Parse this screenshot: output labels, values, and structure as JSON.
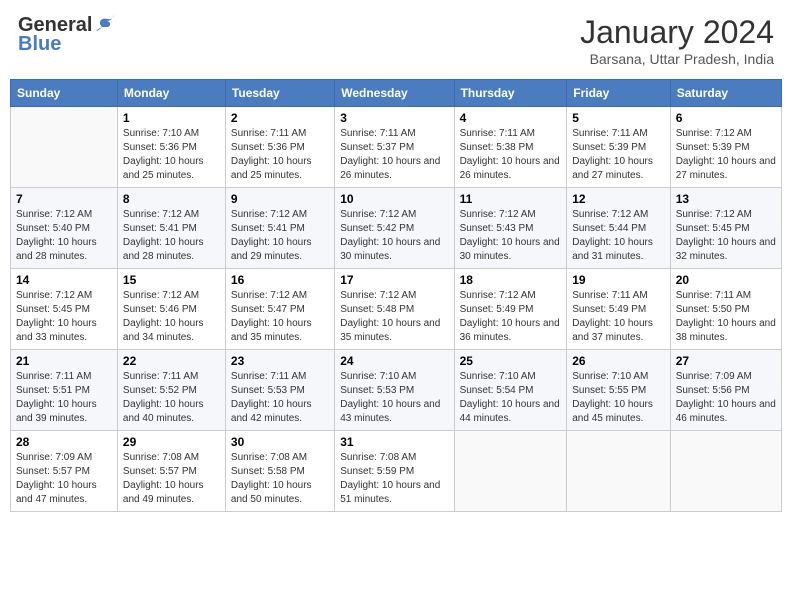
{
  "logo": {
    "general": "General",
    "blue": "Blue"
  },
  "title": "January 2024",
  "location": "Barsana, Uttar Pradesh, India",
  "headers": [
    "Sunday",
    "Monday",
    "Tuesday",
    "Wednesday",
    "Thursday",
    "Friday",
    "Saturday"
  ],
  "weeks": [
    [
      {
        "day": "",
        "sunrise": "",
        "sunset": "",
        "daylight": ""
      },
      {
        "day": "1",
        "sunrise": "Sunrise: 7:10 AM",
        "sunset": "Sunset: 5:36 PM",
        "daylight": "Daylight: 10 hours and 25 minutes."
      },
      {
        "day": "2",
        "sunrise": "Sunrise: 7:11 AM",
        "sunset": "Sunset: 5:36 PM",
        "daylight": "Daylight: 10 hours and 25 minutes."
      },
      {
        "day": "3",
        "sunrise": "Sunrise: 7:11 AM",
        "sunset": "Sunset: 5:37 PM",
        "daylight": "Daylight: 10 hours and 26 minutes."
      },
      {
        "day": "4",
        "sunrise": "Sunrise: 7:11 AM",
        "sunset": "Sunset: 5:38 PM",
        "daylight": "Daylight: 10 hours and 26 minutes."
      },
      {
        "day": "5",
        "sunrise": "Sunrise: 7:11 AM",
        "sunset": "Sunset: 5:39 PM",
        "daylight": "Daylight: 10 hours and 27 minutes."
      },
      {
        "day": "6",
        "sunrise": "Sunrise: 7:12 AM",
        "sunset": "Sunset: 5:39 PM",
        "daylight": "Daylight: 10 hours and 27 minutes."
      }
    ],
    [
      {
        "day": "7",
        "sunrise": "Sunrise: 7:12 AM",
        "sunset": "Sunset: 5:40 PM",
        "daylight": "Daylight: 10 hours and 28 minutes."
      },
      {
        "day": "8",
        "sunrise": "Sunrise: 7:12 AM",
        "sunset": "Sunset: 5:41 PM",
        "daylight": "Daylight: 10 hours and 28 minutes."
      },
      {
        "day": "9",
        "sunrise": "Sunrise: 7:12 AM",
        "sunset": "Sunset: 5:41 PM",
        "daylight": "Daylight: 10 hours and 29 minutes."
      },
      {
        "day": "10",
        "sunrise": "Sunrise: 7:12 AM",
        "sunset": "Sunset: 5:42 PM",
        "daylight": "Daylight: 10 hours and 30 minutes."
      },
      {
        "day": "11",
        "sunrise": "Sunrise: 7:12 AM",
        "sunset": "Sunset: 5:43 PM",
        "daylight": "Daylight: 10 hours and 30 minutes."
      },
      {
        "day": "12",
        "sunrise": "Sunrise: 7:12 AM",
        "sunset": "Sunset: 5:44 PM",
        "daylight": "Daylight: 10 hours and 31 minutes."
      },
      {
        "day": "13",
        "sunrise": "Sunrise: 7:12 AM",
        "sunset": "Sunset: 5:45 PM",
        "daylight": "Daylight: 10 hours and 32 minutes."
      }
    ],
    [
      {
        "day": "14",
        "sunrise": "Sunrise: 7:12 AM",
        "sunset": "Sunset: 5:45 PM",
        "daylight": "Daylight: 10 hours and 33 minutes."
      },
      {
        "day": "15",
        "sunrise": "Sunrise: 7:12 AM",
        "sunset": "Sunset: 5:46 PM",
        "daylight": "Daylight: 10 hours and 34 minutes."
      },
      {
        "day": "16",
        "sunrise": "Sunrise: 7:12 AM",
        "sunset": "Sunset: 5:47 PM",
        "daylight": "Daylight: 10 hours and 35 minutes."
      },
      {
        "day": "17",
        "sunrise": "Sunrise: 7:12 AM",
        "sunset": "Sunset: 5:48 PM",
        "daylight": "Daylight: 10 hours and 35 minutes."
      },
      {
        "day": "18",
        "sunrise": "Sunrise: 7:12 AM",
        "sunset": "Sunset: 5:49 PM",
        "daylight": "Daylight: 10 hours and 36 minutes."
      },
      {
        "day": "19",
        "sunrise": "Sunrise: 7:11 AM",
        "sunset": "Sunset: 5:49 PM",
        "daylight": "Daylight: 10 hours and 37 minutes."
      },
      {
        "day": "20",
        "sunrise": "Sunrise: 7:11 AM",
        "sunset": "Sunset: 5:50 PM",
        "daylight": "Daylight: 10 hours and 38 minutes."
      }
    ],
    [
      {
        "day": "21",
        "sunrise": "Sunrise: 7:11 AM",
        "sunset": "Sunset: 5:51 PM",
        "daylight": "Daylight: 10 hours and 39 minutes."
      },
      {
        "day": "22",
        "sunrise": "Sunrise: 7:11 AM",
        "sunset": "Sunset: 5:52 PM",
        "daylight": "Daylight: 10 hours and 40 minutes."
      },
      {
        "day": "23",
        "sunrise": "Sunrise: 7:11 AM",
        "sunset": "Sunset: 5:53 PM",
        "daylight": "Daylight: 10 hours and 42 minutes."
      },
      {
        "day": "24",
        "sunrise": "Sunrise: 7:10 AM",
        "sunset": "Sunset: 5:53 PM",
        "daylight": "Daylight: 10 hours and 43 minutes."
      },
      {
        "day": "25",
        "sunrise": "Sunrise: 7:10 AM",
        "sunset": "Sunset: 5:54 PM",
        "daylight": "Daylight: 10 hours and 44 minutes."
      },
      {
        "day": "26",
        "sunrise": "Sunrise: 7:10 AM",
        "sunset": "Sunset: 5:55 PM",
        "daylight": "Daylight: 10 hours and 45 minutes."
      },
      {
        "day": "27",
        "sunrise": "Sunrise: 7:09 AM",
        "sunset": "Sunset: 5:56 PM",
        "daylight": "Daylight: 10 hours and 46 minutes."
      }
    ],
    [
      {
        "day": "28",
        "sunrise": "Sunrise: 7:09 AM",
        "sunset": "Sunset: 5:57 PM",
        "daylight": "Daylight: 10 hours and 47 minutes."
      },
      {
        "day": "29",
        "sunrise": "Sunrise: 7:08 AM",
        "sunset": "Sunset: 5:57 PM",
        "daylight": "Daylight: 10 hours and 49 minutes."
      },
      {
        "day": "30",
        "sunrise": "Sunrise: 7:08 AM",
        "sunset": "Sunset: 5:58 PM",
        "daylight": "Daylight: 10 hours and 50 minutes."
      },
      {
        "day": "31",
        "sunrise": "Sunrise: 7:08 AM",
        "sunset": "Sunset: 5:59 PM",
        "daylight": "Daylight: 10 hours and 51 minutes."
      },
      {
        "day": "",
        "sunrise": "",
        "sunset": "",
        "daylight": ""
      },
      {
        "day": "",
        "sunrise": "",
        "sunset": "",
        "daylight": ""
      },
      {
        "day": "",
        "sunrise": "",
        "sunset": "",
        "daylight": ""
      }
    ]
  ]
}
